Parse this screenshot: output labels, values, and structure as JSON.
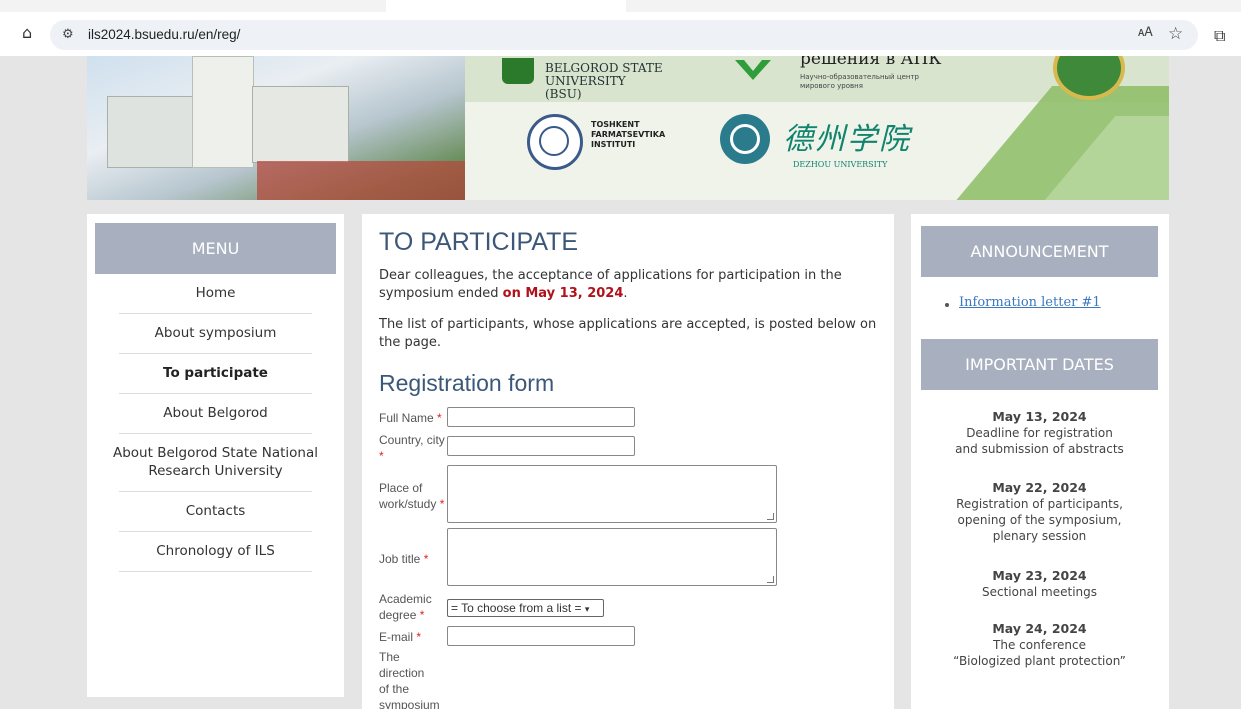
{
  "browser": {
    "url": "ils2024.bsuedu.ru/en/reg/"
  },
  "banner": {
    "bsu_name": "BELGOROD STATE UNIVERSITY (BSU)",
    "ru_title": "решения в АПК",
    "ru_subtitle": "Научно-образовательный центр мирового уровня",
    "tashkent_name": "TOSHKENT FARMATSEVTIKA INSTITUTI",
    "dezhou_cn": "德州学院",
    "dezhou_en": "DEZHOU UNIVERSITY"
  },
  "menu": {
    "title": "MENU",
    "items": [
      {
        "label": "Home"
      },
      {
        "label": "About symposium"
      },
      {
        "label": "To participate"
      },
      {
        "label": "About Belgorod"
      },
      {
        "label": "About Belgorod State National Research University"
      },
      {
        "label": "Contacts"
      },
      {
        "label": "Chronology of ILS"
      }
    ]
  },
  "main": {
    "title": "TO PARTICIPATE",
    "intro_prefix": "Dear colleagues, the acceptance of applications for participation in the symposium ended ",
    "intro_highlight": "on May 13, 2024",
    "intro_suffix": ".",
    "list_note": "The list of participants, whose applications are accepted, is posted below on the page.",
    "form_title": "Registration form",
    "form": {
      "full_name_label": "Full Name",
      "country_label": "Country, city",
      "place_label": "Place of work/study",
      "job_label": "Job title",
      "degree_label": "Academic degree",
      "degree_selected": "= To choose from a list =",
      "email_label": "E-mail",
      "direction_label": "The direction of the symposium",
      "required_mark": "*"
    }
  },
  "sidebar": {
    "announcement_title": "ANNOUNCEMENT",
    "announcement_link": "Information letter #1",
    "dates_title": "IMPORTANT DATES",
    "dates": [
      {
        "date": "May 13, 2024",
        "line1": "Deadline for registration",
        "line2": "and submission of abstracts",
        "line3": ""
      },
      {
        "date": "May 22, 2024",
        "line1": "Registration of participants,",
        "line2": "opening of the symposium,",
        "line3": "plenary session"
      },
      {
        "date": "May 23, 2024",
        "line1": "Sectional meetings",
        "line2": "",
        "line3": ""
      },
      {
        "date": "May 24, 2024",
        "line1": "The conference",
        "line2": "“Biologized plant protection”",
        "line3": ""
      }
    ]
  }
}
